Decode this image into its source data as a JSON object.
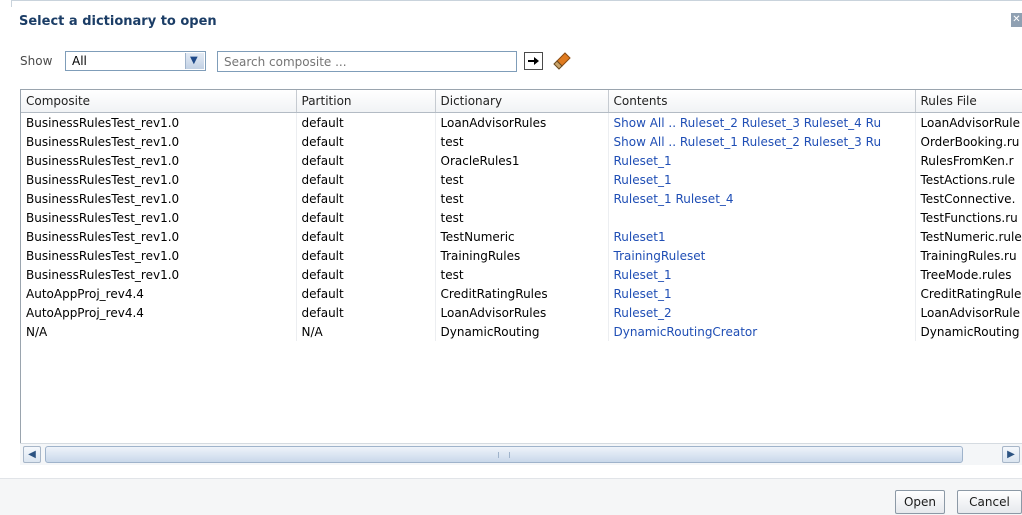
{
  "dialog": {
    "title": "Select a dictionary to open"
  },
  "filter": {
    "show_label": "Show",
    "show_value": "All",
    "search_placeholder": "Search composite ..."
  },
  "table": {
    "columns": [
      "Composite",
      "Partition",
      "Dictionary",
      "Contents",
      "Rules File"
    ],
    "rows": [
      {
        "composite": "BusinessRulesTest_rev1.0",
        "partition": "default",
        "dictionary": "LoanAdvisorRules",
        "contents": [
          "Show All ..",
          "Ruleset_2",
          "Ruleset_3",
          "Ruleset_4",
          "Ru"
        ],
        "rules_file": "LoanAdvisorRule"
      },
      {
        "composite": "BusinessRulesTest_rev1.0",
        "partition": "default",
        "dictionary": "test",
        "contents": [
          "Show All ..",
          "Ruleset_1",
          "Ruleset_2",
          "Ruleset_3",
          "Ru"
        ],
        "rules_file": "OrderBooking.ru"
      },
      {
        "composite": "BusinessRulesTest_rev1.0",
        "partition": "default",
        "dictionary": "OracleRules1",
        "contents": [
          "Ruleset_1"
        ],
        "rules_file": "RulesFromKen.r"
      },
      {
        "composite": "BusinessRulesTest_rev1.0",
        "partition": "default",
        "dictionary": "test",
        "contents": [
          "Ruleset_1"
        ],
        "rules_file": "TestActions.rule"
      },
      {
        "composite": "BusinessRulesTest_rev1.0",
        "partition": "default",
        "dictionary": "test",
        "contents": [
          "Ruleset_1",
          "Ruleset_4"
        ],
        "rules_file": "TestConnective."
      },
      {
        "composite": "BusinessRulesTest_rev1.0",
        "partition": "default",
        "dictionary": "test",
        "contents": [],
        "rules_file": "TestFunctions.ru"
      },
      {
        "composite": "BusinessRulesTest_rev1.0",
        "partition": "default",
        "dictionary": "TestNumeric",
        "contents": [
          "Ruleset1"
        ],
        "rules_file": "TestNumeric.rule"
      },
      {
        "composite": "BusinessRulesTest_rev1.0",
        "partition": "default",
        "dictionary": "TrainingRules",
        "contents": [
          "TrainingRuleset"
        ],
        "rules_file": "TrainingRules.ru"
      },
      {
        "composite": "BusinessRulesTest_rev1.0",
        "partition": "default",
        "dictionary": "test",
        "contents": [
          "Ruleset_1"
        ],
        "rules_file": "TreeMode.rules"
      },
      {
        "composite": "AutoAppProj_rev4.4",
        "partition": "default",
        "dictionary": "CreditRatingRules",
        "contents": [
          "Ruleset_1"
        ],
        "rules_file": "CreditRatingRule"
      },
      {
        "composite": "AutoAppProj_rev4.4",
        "partition": "default",
        "dictionary": "LoanAdvisorRules",
        "contents": [
          "Ruleset_2"
        ],
        "rules_file": "LoanAdvisorRule"
      },
      {
        "composite": "N/A",
        "partition": "N/A",
        "dictionary": "DynamicRouting",
        "contents": [
          "DynamicRoutingCreator"
        ],
        "rules_file": "DynamicRouting"
      }
    ]
  },
  "buttons": {
    "open": "Open",
    "cancel": "Cancel"
  },
  "icons": {
    "close": "close-icon",
    "dropdown": "chevron-down-icon",
    "go": "arrow-right-icon",
    "clear": "eraser-icon",
    "scroll_left": "scroll-left-icon",
    "scroll_right": "scroll-right-icon"
  },
  "colors": {
    "title": "#1b3d66",
    "link": "#1f4eb5",
    "border": "#7f9db9"
  }
}
